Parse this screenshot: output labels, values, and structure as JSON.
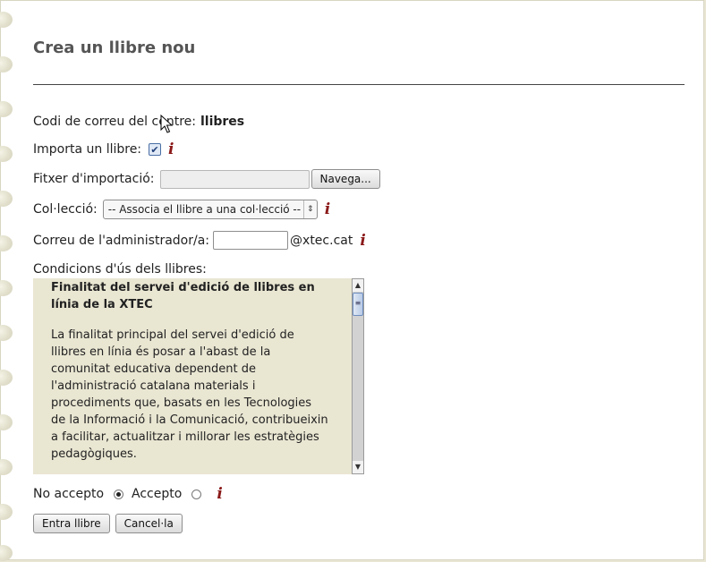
{
  "page": {
    "title": "Crea un llibre nou"
  },
  "fields": {
    "codi_label": "Codi de correu del centre:",
    "codi_value": "llibres",
    "importa_label": "Importa un llibre:",
    "importa_checked": true,
    "fitxer_label": "Fitxer d'importació:",
    "navega_label": "Navega...",
    "colleccio_label": "Col·lecció:",
    "colleccio_selected": "-- Associa el llibre a una col·lecció --",
    "correu_label": "Correu de l'administrador/a:",
    "correu_value": "",
    "correu_domain": "@xtec.cat"
  },
  "info_icon": "i",
  "terms": {
    "label": "Condicions d'ús dels llibres:",
    "title": "Finalitat del servei d'edició de llibres en línia de la XTEC",
    "body": "La finalitat principal del servei d'edició de llibres en línia és posar a l'abast de la comunitat educativa dependent de l'administració catalana materials i procediments que, basats en les Tecnologies de la Informació i la Comunicació, contribueixin a facilitar, actualitzar i millorar les estratègies pedagògiques."
  },
  "acceptance": {
    "no_accepto": "No accepto",
    "accepto": "Accepto",
    "selected": "no_accepto"
  },
  "buttons": {
    "submit": "Entra llibre",
    "cancel": "Cancel·la"
  },
  "icons": {
    "info": "info-icon",
    "checkmark": "checkmark-icon",
    "dropdown": "chevron-updown-icon",
    "scroll_up": "scroll-up-icon",
    "scroll_down": "scroll-down-icon",
    "cursor": "mouse-pointer-icon"
  },
  "colors": {
    "info_icon": "#8b1a1a",
    "terms_bg": "#e9e6d2",
    "page_bg": "#ffffff"
  }
}
